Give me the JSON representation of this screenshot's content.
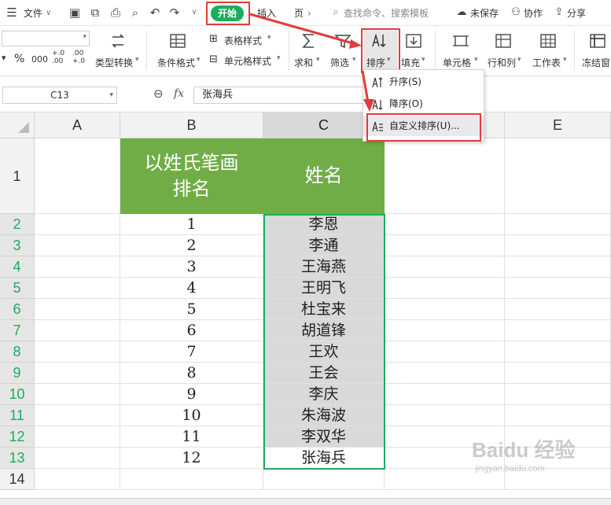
{
  "menubar": {
    "file_label": "文件",
    "tab_start": "开始",
    "tab_insert": "插入",
    "tab_page": "页",
    "search_placeholder": "查找命令、搜索模板",
    "unsaved": "未保存",
    "collab": "协作",
    "share": "分享"
  },
  "ribbon": {
    "percent": "%",
    "thousands": "000",
    "dec_increase": "+.0 .00",
    "dec_decrease": ".00 +.0",
    "type_convert": "类型转换",
    "cond_format": "条件格式",
    "table_style": "表格样式",
    "cell_style": "单元格样式",
    "sum": "求和",
    "filter": "筛选",
    "sort": "排序",
    "fill": "填充",
    "cell": "单元格",
    "row_col": "行和列",
    "worksheet": "工作表",
    "freeze": "冻结窗"
  },
  "formula_bar": {
    "name_box": "C13",
    "fx": "fx",
    "value": "张海兵"
  },
  "sort_menu": {
    "items": [
      {
        "label": "升序(S)"
      },
      {
        "label": "降序(O)"
      },
      {
        "label": "自定义排序(U)..."
      }
    ]
  },
  "sheet": {
    "columns": [
      "A",
      "B",
      "C",
      "E"
    ],
    "row_numbers": [
      "1",
      "2",
      "3",
      "4",
      "5",
      "6",
      "7",
      "8",
      "9",
      "10",
      "11",
      "12",
      "13",
      "14"
    ],
    "header_b": "以姓氏笔画排名",
    "header_c": "姓名",
    "rank": [
      "1",
      "2",
      "3",
      "4",
      "5",
      "6",
      "7",
      "8",
      "9",
      "10",
      "11",
      "12"
    ],
    "names": [
      "李恩",
      "李通",
      "王海燕",
      "王明飞",
      "杜宝来",
      "胡道锋",
      "王欢",
      "王会",
      "李庆",
      "朱海波",
      "李双华",
      "张海兵"
    ]
  },
  "watermark": {
    "brand": "Baidu 经验",
    "url": "jingyan.baidu.com"
  },
  "colors": {
    "accent": "#1aae5c",
    "header_fill": "#70ad47",
    "highlight_red": "#e23b3b",
    "selected_cell_fill": "#d9d9d9"
  }
}
